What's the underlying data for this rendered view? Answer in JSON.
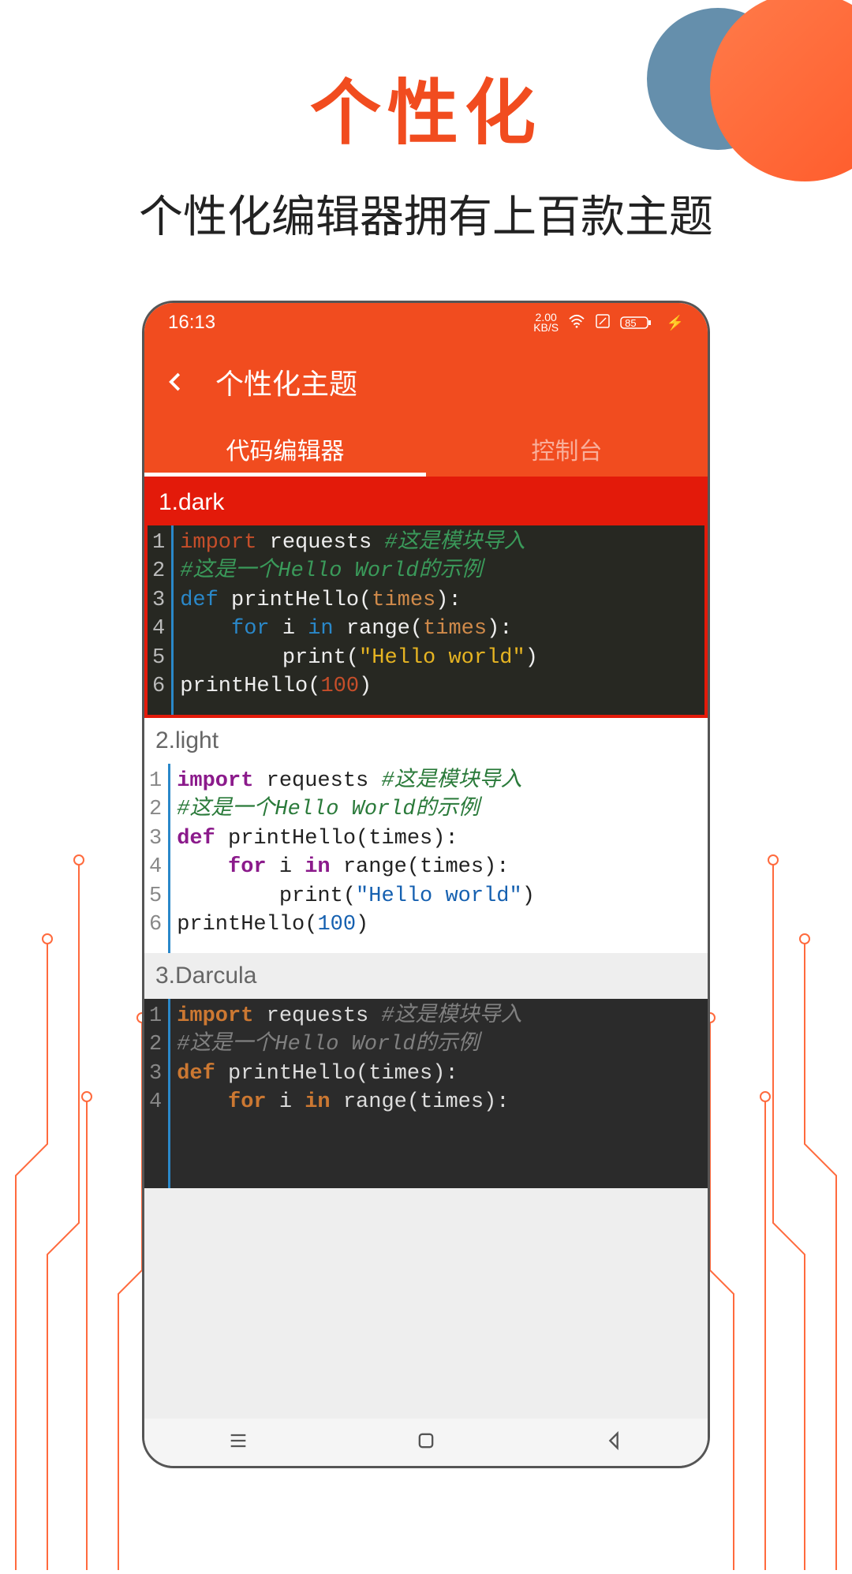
{
  "page": {
    "title": "个性化",
    "subtitle": "个性化编辑器拥有上百款主题"
  },
  "status": {
    "time": "16:13",
    "net_speed_value": "2.00",
    "net_speed_unit": "KB/S",
    "battery": "85"
  },
  "header": {
    "title": "个性化主题"
  },
  "tabs": {
    "editor": "代码编辑器",
    "console": "控制台"
  },
  "themes": [
    {
      "label": "1.dark",
      "variant": "dark",
      "selected": true
    },
    {
      "label": "2.light",
      "variant": "light",
      "selected": false
    },
    {
      "label": "3.Darcula",
      "variant": "darcula",
      "selected": false
    }
  ],
  "code_sample": {
    "lines": [
      {
        "n": "1",
        "tokens": [
          {
            "t": "import",
            "c": "kw"
          },
          {
            "t": " requests ",
            "c": "cl"
          },
          {
            "t": "#这是模块导入",
            "c": "cm"
          }
        ]
      },
      {
        "n": "2",
        "tokens": [
          {
            "t": "#这是一个Hello World的示例",
            "c": "cm"
          }
        ]
      },
      {
        "n": "3",
        "tokens": [
          {
            "t": "def",
            "c": "kw2"
          },
          {
            "t": " printHello(",
            "c": "fn"
          },
          {
            "t": "times",
            "c": "par"
          },
          {
            "t": "):",
            "c": "fn"
          }
        ]
      },
      {
        "n": "4",
        "tokens": [
          {
            "t": "    ",
            "c": "cl"
          },
          {
            "t": "for",
            "c": "kw2"
          },
          {
            "t": " i ",
            "c": "cl"
          },
          {
            "t": "in",
            "c": "kw2"
          },
          {
            "t": " range(",
            "c": "cl"
          },
          {
            "t": "times",
            "c": "par"
          },
          {
            "t": "):",
            "c": "cl"
          }
        ]
      },
      {
        "n": "5",
        "tokens": [
          {
            "t": "        print(",
            "c": "cl"
          },
          {
            "t": "\"Hello world\"",
            "c": "str"
          },
          {
            "t": ")",
            "c": "cl"
          }
        ]
      },
      {
        "n": "6",
        "tokens": [
          {
            "t": "printHello(",
            "c": "cl"
          },
          {
            "t": "100",
            "c": "num"
          },
          {
            "t": ")",
            "c": "cl"
          }
        ]
      }
    ]
  }
}
